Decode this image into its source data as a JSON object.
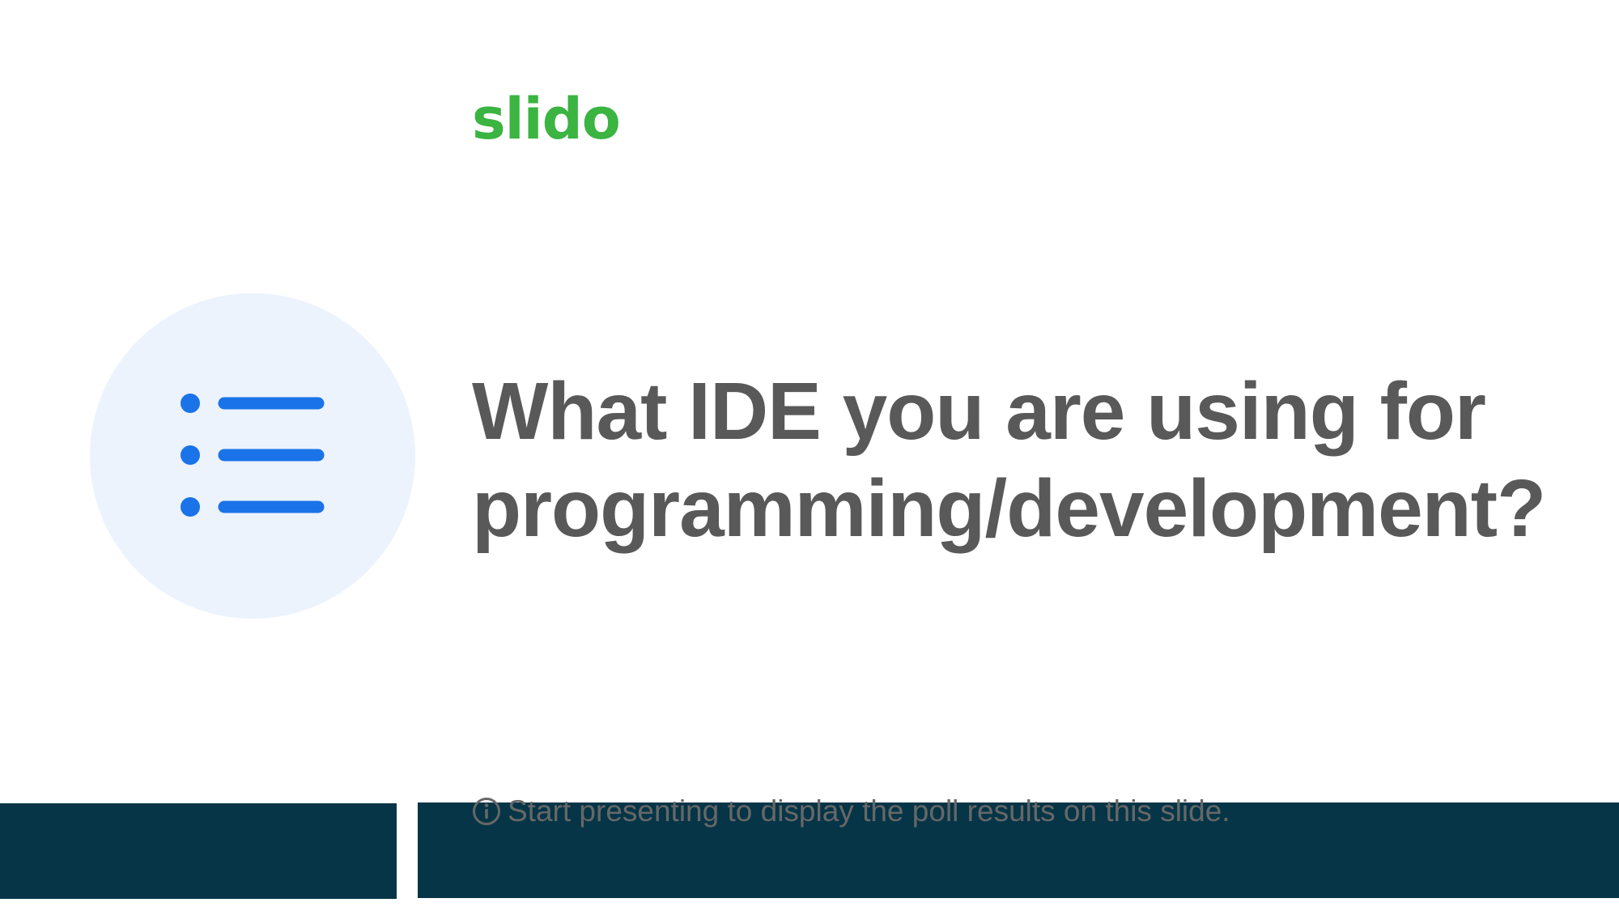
{
  "brand": {
    "logo_text": "slido",
    "logo_color": "#3bb441"
  },
  "poll": {
    "type_icon": "bulleted-list-icon",
    "question": "What IDE you are using for programming/development?",
    "hint_icon": "info-icon",
    "hint": "Start presenting to display the poll results on this slide."
  },
  "colors": {
    "text": "#595959",
    "icon_blue": "#1a73e8",
    "icon_circle": "#ecf3fd",
    "footer_bar": "#053547"
  }
}
